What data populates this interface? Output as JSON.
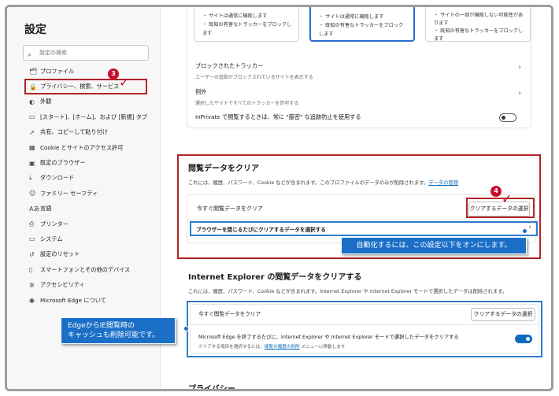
{
  "sidebar": {
    "title": "設定",
    "search_placeholder": "設定の検索",
    "items": [
      {
        "icon": "🗂",
        "label": "プロファイル"
      },
      {
        "icon": "🔒",
        "label": "プライバシー、検索、サービス"
      },
      {
        "icon": "◐",
        "label": "外観"
      },
      {
        "icon": "▭",
        "label": "[スタート]、[ホーム]、および [新規] タブ"
      },
      {
        "icon": "↗",
        "label": "共有、コピーして貼り付け"
      },
      {
        "icon": "▦",
        "label": "Cookie とサイトのアクセス許可"
      },
      {
        "icon": "▣",
        "label": "既定のブラウザー"
      },
      {
        "icon": "⤓",
        "label": "ダウンロード"
      },
      {
        "icon": "☺",
        "label": "ファミリー セーフティ"
      },
      {
        "icon": "Aあ",
        "label": "言語"
      },
      {
        "icon": "⎙",
        "label": "プリンター"
      },
      {
        "icon": "▭",
        "label": "システム"
      },
      {
        "icon": "↺",
        "label": "設定のリセット"
      },
      {
        "icon": "▯",
        "label": "スマートフォンとその他のデバイス"
      },
      {
        "icon": "✲",
        "label": "アクセシビリティ"
      },
      {
        "icon": "◉",
        "label": "Microsoft Edge について"
      }
    ]
  },
  "prevention": {
    "col1": [
      "・ サイトは通常に機能します",
      "・ 既知の有害なトラッカーをブロックします"
    ],
    "col2": [
      "・ サイトは通常に機能します",
      "・ 既知の有害なトラッカーをブロックします"
    ],
    "col3": [
      "・ サイトの一部が機能しない可能性があります",
      "・ 既知の有害なトラッカーをブロックします"
    ],
    "blocked_title": "ブロックされたトラッカー",
    "blocked_sub": "ユーザーの追跡がブロックされているサイトを表示する",
    "exceptions_title": "例外",
    "exceptions_sub": "選択したサイトですべてのトラッカーを許可する",
    "inprivate_label": "InPrivate で閲覧するときは、常に \"厳密\" な追跡防止を使用する"
  },
  "clear_data": {
    "title": "閲覧データをクリア",
    "desc": "これには、履歴、パスワード、Cookie などが含まれます。このプロファイルのデータのみが削除されます。",
    "manage_link": "データの管理",
    "now_label": "今すぐ閲覧データをクリア",
    "choose_button": "クリアするデータの選択",
    "on_close_label": "ブラウザーを閉じるたびにクリアするデータを選択する"
  },
  "ie_clear": {
    "title": "Internet Explorer の閲覧データをクリアする",
    "desc": "これには、履歴、パスワード、Cookie などが含まれます。Internet Explorer や Internet Explorer モードで選択したデータは削除されます。",
    "now_label": "今すぐ閲覧データをクリア",
    "choose_button": "クリアするデータの選択",
    "exit_label": "Microsoft Edge を終了するたびに、Internet Explorer や Internet Explorer モードで選択したデータをクリアする",
    "exit_sub_prefix": "クリアする項目を選択するには、",
    "exit_sub_link": "閲覧の履歴の削除",
    "exit_sub_suffix": " メニューに移動します"
  },
  "next_section": "プライバシー",
  "annotations": {
    "callout_auto": "自動化するには、この設定以下をオンにします。",
    "callout_ie_line1": "EdgeからIE閲覧時の",
    "callout_ie_line2": "キャッシュも削除可能です。",
    "step3": "3",
    "step4": "4"
  },
  "colors": {
    "accent": "#0f6cbd",
    "annotation_red": "#b0252a",
    "annotation_blue": "#1b6fc7"
  }
}
